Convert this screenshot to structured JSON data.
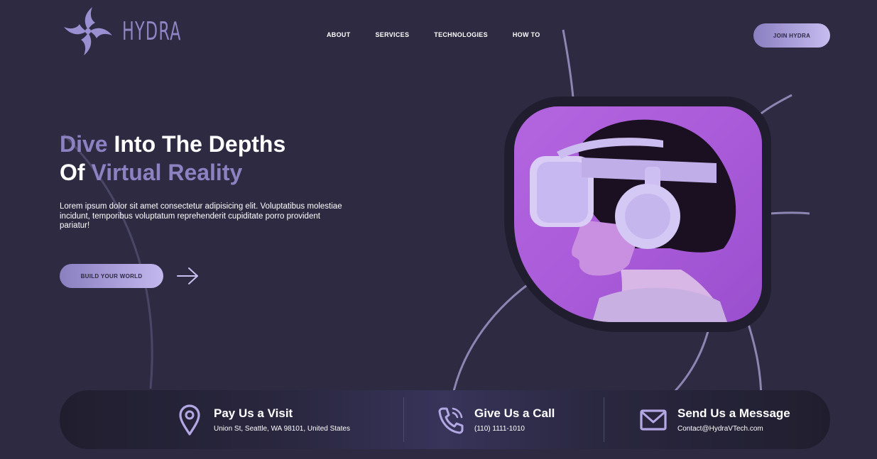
{
  "brand": {
    "name": "HYDRA"
  },
  "nav": {
    "items": [
      {
        "label": "ABOUT"
      },
      {
        "label": "SERVICES"
      },
      {
        "label": "TECHNOLOGIES"
      },
      {
        "label": "HOW TO"
      }
    ],
    "join_label": "JOIN HYDRA"
  },
  "hero": {
    "title_line1_accent": "Dive",
    "title_line1_rest": " Into The Depths",
    "title_line2_start": "Of ",
    "title_line2_accent": "Virtual Reality",
    "description": "Lorem ipsum dolor sit amet consectetur adipisicing elit. Voluptatibus molestiae incidunt, temporibus voluptatum reprehenderit cupiditate porro provident pariatur!",
    "cta_label": "BUILD YOUR WORLD"
  },
  "contact": [
    {
      "title": "Pay Us a Visit",
      "detail": "Union St, Seattle, WA 98101, United States",
      "icon": "location-pin-icon"
    },
    {
      "title": "Give Us a Call",
      "detail": "(110) 1111-1010",
      "icon": "phone-icon"
    },
    {
      "title": "Send Us a Message",
      "detail": "Contact@HydraVTech.com",
      "icon": "mail-icon"
    }
  ],
  "colors": {
    "background": "#2d2a42",
    "accent": "#8c82c2",
    "button_gradient_start": "#8a7fc0",
    "button_gradient_end": "#c7bdf0",
    "image_purple": "#b466e0"
  }
}
